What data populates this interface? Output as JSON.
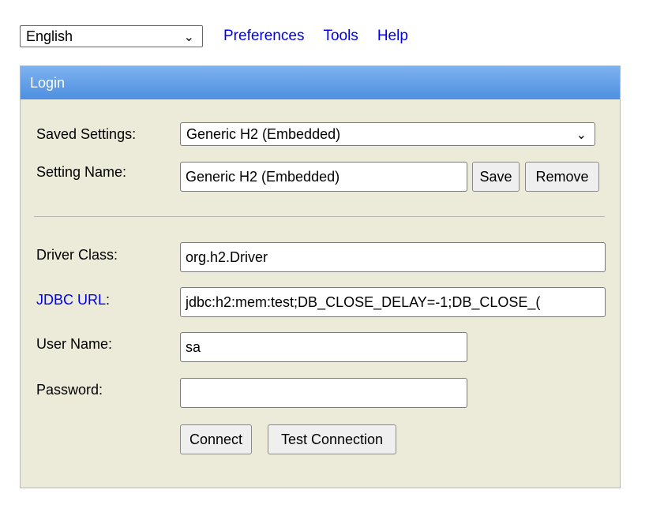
{
  "topbar": {
    "language": "English",
    "links": [
      "Preferences",
      "Tools",
      "Help"
    ]
  },
  "login": {
    "title": "Login",
    "saved_settings_label": "Saved Settings:",
    "saved_settings_value": "Generic H2 (Embedded)",
    "setting_name_label": "Setting Name:",
    "setting_name_value": "Generic H2 (Embedded)",
    "save_label": "Save",
    "remove_label": "Remove",
    "driver_class_label": "Driver Class:",
    "driver_class_value": "org.h2.Driver",
    "jdbc_url_label": "JDBC URL",
    "jdbc_url_colon": ":",
    "jdbc_url_value": "jdbc:h2:mem:test;DB_CLOSE_DELAY=-1;DB_CLOSE_(",
    "user_name_label": "User Name:",
    "user_name_value": "sa",
    "password_label": "Password:",
    "password_value": "",
    "connect_label": "Connect",
    "test_connection_label": "Test Connection"
  },
  "icons": {
    "dropdown": "chevron-down-icon"
  },
  "colors": {
    "link": "#0000ee",
    "header_top": "#7eb2ef",
    "header_bottom": "#4d8fe0",
    "panel_bg": "#ecead9"
  }
}
